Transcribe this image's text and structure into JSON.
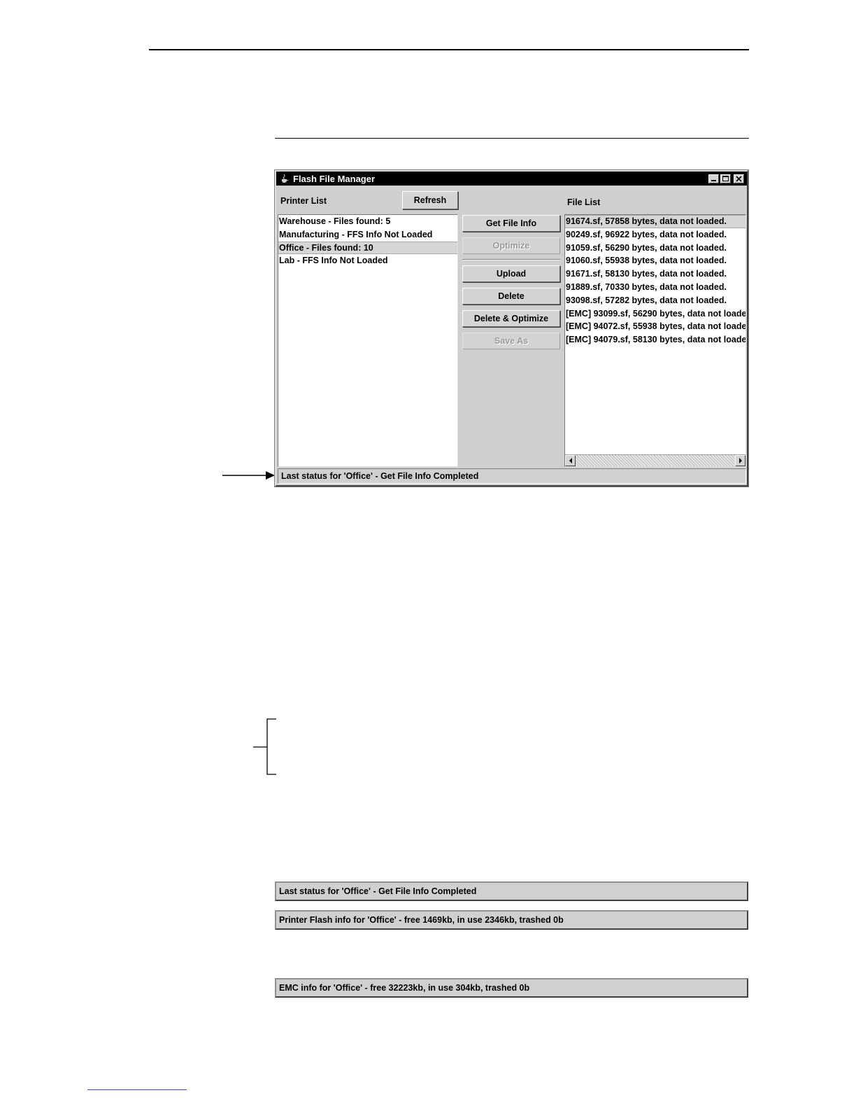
{
  "window": {
    "title": "Flash File Manager",
    "printer_list_label": "Printer List",
    "refresh_label": "Refresh",
    "file_list_label": "File List",
    "printers": [
      {
        "label": "Warehouse - Files found: 5",
        "selected": false
      },
      {
        "label": "Manufacturing - FFS Info Not Loaded",
        "selected": false
      },
      {
        "label": "Office - Files found: 10",
        "selected": true
      },
      {
        "label": "Lab - FFS Info Not Loaded",
        "selected": false
      }
    ],
    "actions": {
      "get_file_info": "Get File Info",
      "optimize": "Optimize",
      "upload": "Upload",
      "delete": "Delete",
      "delete_optimize": "Delete & Optimize",
      "save_as": "Save As"
    },
    "files": [
      {
        "label": "91674.sf, 57858 bytes, data not loaded.",
        "selected": true
      },
      {
        "label": "90249.sf, 96922 bytes, data not loaded.",
        "selected": false
      },
      {
        "label": "91059.sf, 56290 bytes, data not loaded.",
        "selected": false
      },
      {
        "label": "91060.sf, 55938 bytes, data not loaded.",
        "selected": false
      },
      {
        "label": "91671.sf, 58130 bytes, data not loaded.",
        "selected": false
      },
      {
        "label": "91889.sf, 70330 bytes, data not loaded.",
        "selected": false
      },
      {
        "label": "93098.sf, 57282 bytes, data not loaded.",
        "selected": false
      },
      {
        "label": "[EMC] 93099.sf, 56290 bytes, data not loade",
        "selected": false
      },
      {
        "label": "[EMC] 94072.sf, 55938 bytes, data not loade",
        "selected": false
      },
      {
        "label": "[EMC] 94079.sf, 58130 bytes, data not loade",
        "selected": false
      }
    ],
    "status": "Last status for 'Office' - Get File Info Completed"
  },
  "status_examples": [
    "Last status for 'Office' - Get File Info Completed",
    "Printer Flash info for 'Office' - free 1469kb, in use 2346kb, trashed 0b",
    "EMC info for 'Office' - free 32223kb, in use 304kb, trashed 0b"
  ]
}
